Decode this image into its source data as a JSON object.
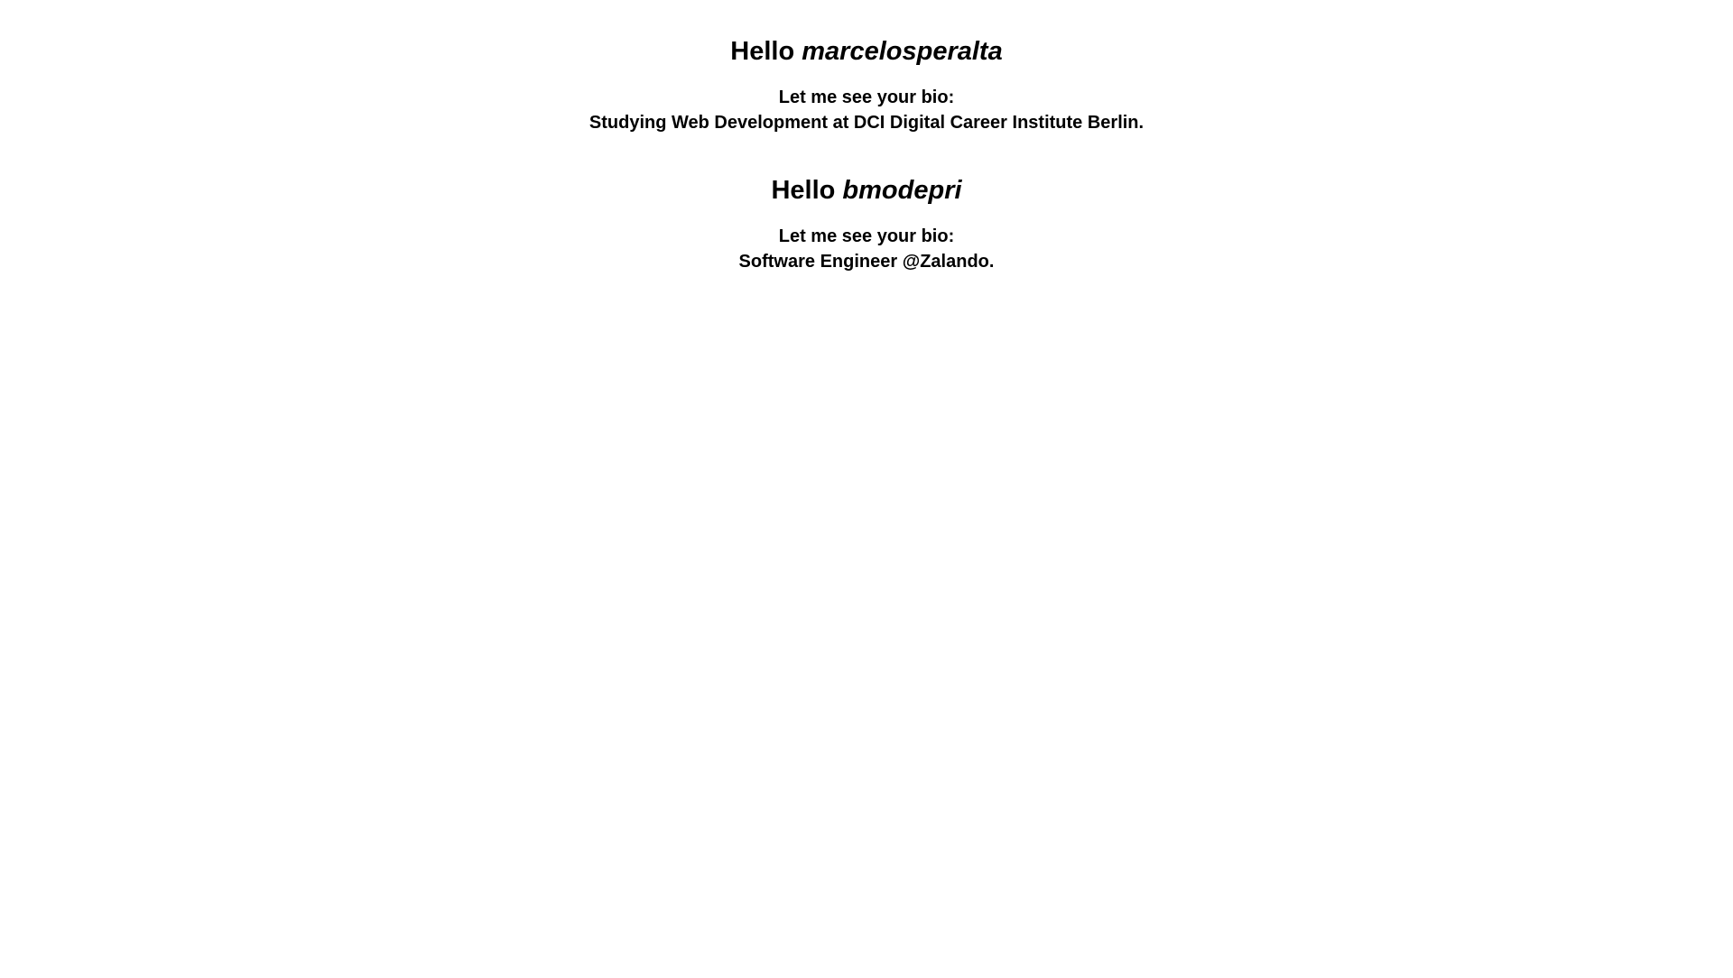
{
  "users": [
    {
      "greeting": "Hello",
      "username": "marcelosperalta",
      "bio_label": "Let me see your bio:",
      "bio": "Studying Web Development at DCI Digital Career Institute Berlin."
    },
    {
      "greeting": "Hello",
      "username": "bmodepri",
      "bio_label": "Let me see your bio:",
      "bio": "Software Engineer @Zalando."
    }
  ]
}
